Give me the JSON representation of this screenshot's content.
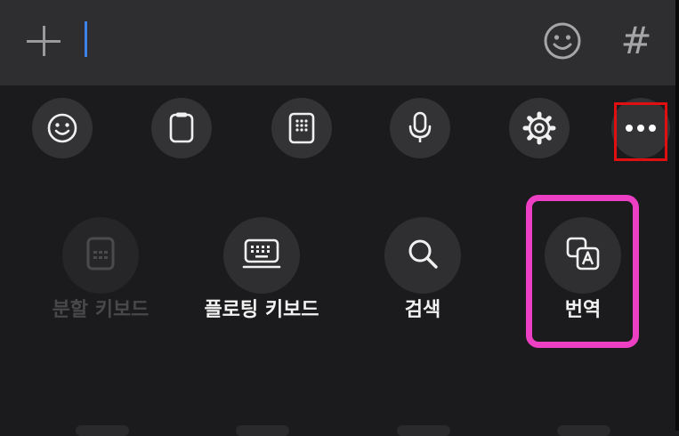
{
  "input_bar": {
    "add_icon": "plus-icon",
    "emoji_icon": "smiley-icon",
    "hash_label": "#"
  },
  "toolbar": {
    "items": [
      {
        "icon": "smiley-icon"
      },
      {
        "icon": "clipboard-icon"
      },
      {
        "icon": "keypad-icon"
      },
      {
        "icon": "microphone-icon"
      },
      {
        "icon": "gear-icon"
      },
      {
        "icon": "more-dots-icon"
      }
    ]
  },
  "grid": {
    "items": [
      {
        "label": "분할 키보드",
        "icon": "split-keyboard-icon",
        "enabled": false
      },
      {
        "label": "플로팅 키보드",
        "icon": "floating-keyboard-icon",
        "enabled": true
      },
      {
        "label": "검색",
        "icon": "search-icon",
        "enabled": true
      },
      {
        "label": "번역",
        "icon": "translate-icon",
        "enabled": true
      }
    ]
  },
  "colors": {
    "cursor": "#3d82e6",
    "more_highlight": "#e01010",
    "translate_highlight": "#ec3fc4"
  }
}
